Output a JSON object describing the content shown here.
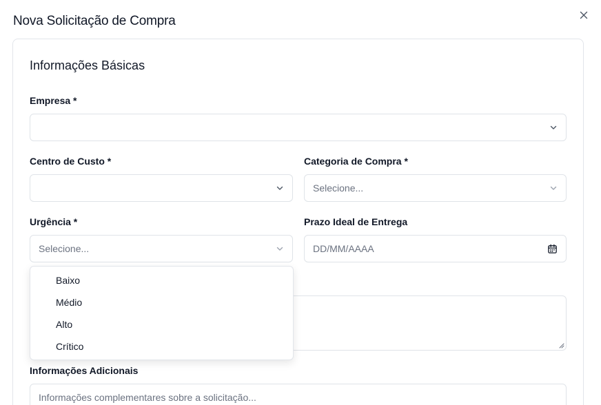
{
  "dialog": {
    "title": "Nova Solicitação de Compra",
    "close_icon": "close-icon"
  },
  "section": {
    "title": "Informações Básicas"
  },
  "fields": {
    "empresa": {
      "label": "Empresa *",
      "value": ""
    },
    "centro_custo": {
      "label": "Centro de Custo *",
      "value": ""
    },
    "categoria": {
      "label": "Categoria de Compra *",
      "value": "Selecione..."
    },
    "urgencia": {
      "label": "Urgência *",
      "value": "Selecione..."
    },
    "prazo": {
      "label": "Prazo Ideal de Entrega",
      "placeholder": "DD/MM/AAAA",
      "icon": "calendar-icon"
    },
    "info_adicionais": {
      "label": "Informações Adicionais",
      "placeholder": "Informações complementares sobre a solicitação..."
    }
  },
  "urgencia_dropdown": {
    "options": [
      "Baixo",
      "Médio",
      "Alto",
      "Crítico"
    ]
  },
  "colors": {
    "border": "#dfe3e8",
    "text": "#111827",
    "muted": "#6b7280"
  }
}
